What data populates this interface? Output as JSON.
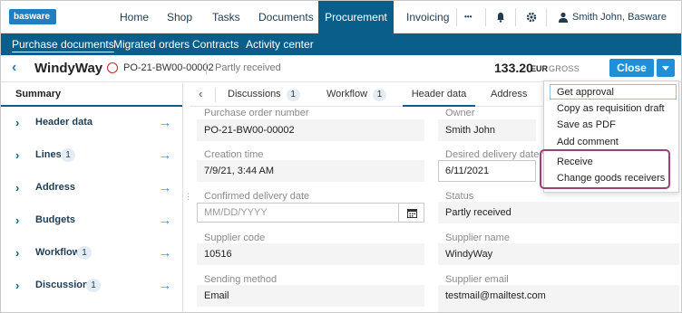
{
  "brand": {
    "logo": "basware",
    "accent": "#0a5f8a",
    "button": "#1f8fd6"
  },
  "topnav": {
    "items": [
      "Home",
      "Shop",
      "Tasks",
      "Documents",
      "Procurement",
      "Invoicing"
    ],
    "active": "Procurement",
    "more_label": "•••",
    "user": "Smith John, Basware Oyj"
  },
  "subnav": {
    "items": [
      "Purchase documents",
      "Migrated orders",
      "Contracts",
      "Activity center"
    ]
  },
  "document": {
    "supplier": "WindyWay",
    "po_number": "PO-21-BW00-00002",
    "status": "Partly received",
    "amount": "133.20",
    "currency": "EUR",
    "amount_type": "GROSS",
    "close_label": "Close"
  },
  "summary": {
    "title": "Summary",
    "items": [
      {
        "label": "Header data",
        "badge": ""
      },
      {
        "label": "Lines",
        "badge": "1"
      },
      {
        "label": "Address",
        "badge": ""
      },
      {
        "label": "Budgets",
        "badge": ""
      },
      {
        "label": "Workflow",
        "badge": "1"
      },
      {
        "label": "Discussions",
        "badge": "1"
      }
    ]
  },
  "tabs": [
    {
      "label": "Discussions",
      "badge": "1"
    },
    {
      "label": "Workflow",
      "badge": "1"
    },
    {
      "label": "Header data",
      "badge": ""
    },
    {
      "label": "Address",
      "badge": ""
    }
  ],
  "fields": {
    "po_number_label": "Purchase order number",
    "po_number_value": "PO-21-BW00-00002",
    "owner_label": "Owner",
    "owner_value": "Smith John",
    "creation_label": "Creation time",
    "creation_value": "7/9/21, 3:44 AM",
    "desired_label": "Desired delivery date *",
    "desired_value": "6/11/2021",
    "confirmed_label": "Confirmed delivery date",
    "confirmed_placeholder": "MM/DD/YYYY",
    "status_label": "Status",
    "status_value": "Partly received",
    "supplier_code_label": "Supplier code",
    "supplier_code_value": "10516",
    "supplier_name_label": "Supplier name",
    "supplier_name_value": "WindyWay",
    "sending_label": "Sending method",
    "sending_value": "Email",
    "supplier_email_label": "Supplier email",
    "supplier_email_value": "testmail@mailtest.com"
  },
  "menu": {
    "items": [
      "Get approval",
      "Copy as requisition draft",
      "Save as PDF",
      "Add comment",
      "Receive",
      "Change goods receivers"
    ],
    "highlight_color": "#9d3f79"
  }
}
